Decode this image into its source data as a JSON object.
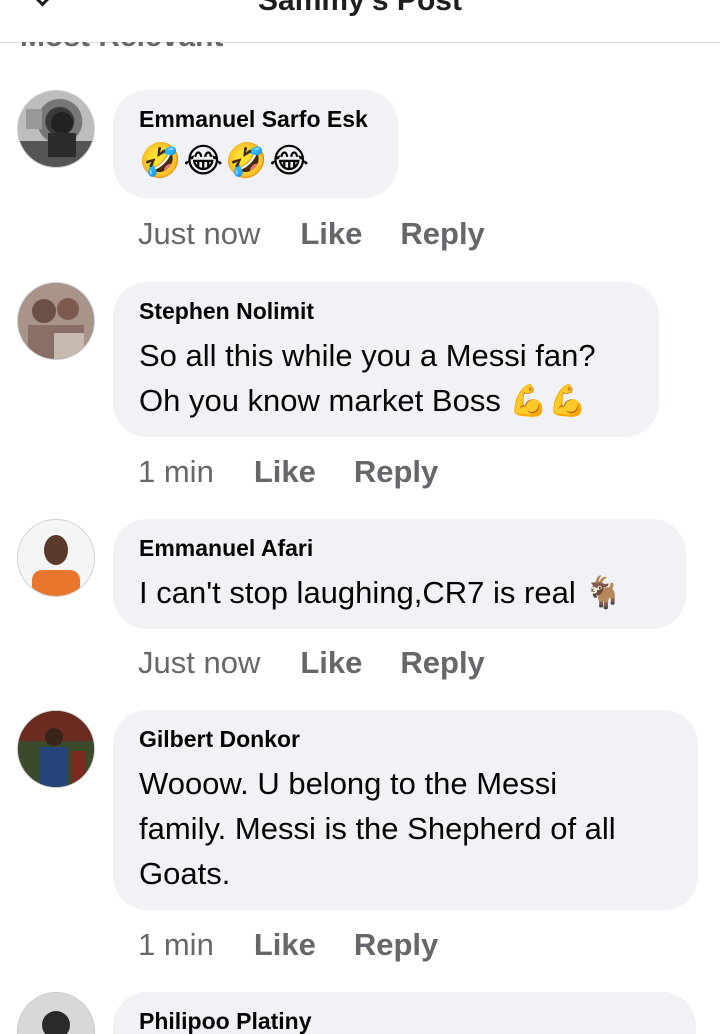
{
  "header": {
    "title": "Sammy's Post",
    "sort_label": "Most Relevant"
  },
  "colors": {
    "bubble": "#f0f2f5",
    "secondary_text": "#65676b",
    "primary_text": "#050505"
  },
  "comments": [
    {
      "author": "Emmanuel Sarfo Esk",
      "text": "",
      "emojis": "🤣😂🤣😂",
      "time": "Just now",
      "like": "Like",
      "reply": "Reply",
      "avatar_icon": "person-photo-bw"
    },
    {
      "author": "Stephen Nolimit",
      "text_lines": [
        "So all this while you a Messi fan?",
        "Oh you know market Boss 💪💪"
      ],
      "time": "1 min",
      "like": "Like",
      "reply": "Reply",
      "avatar_icon": "group-photo"
    },
    {
      "author": "Emmanuel Afari",
      "text": "I can't stop laughing,CR7 is real 🐐",
      "time": "Just now",
      "like": "Like",
      "reply": "Reply",
      "avatar_icon": "person-orange-shirt"
    },
    {
      "author": "Gilbert Donkor",
      "text_lines": [
        "Wooow. U belong to the Messi",
        "family. Messi is the Shepherd of all",
        "Goats."
      ],
      "time": "1 min",
      "like": "Like",
      "reply": "Reply",
      "avatar_icon": "person-speaking-stage"
    },
    {
      "author": "Philipoo Platiny",
      "avatar_icon": "person-photo"
    }
  ]
}
